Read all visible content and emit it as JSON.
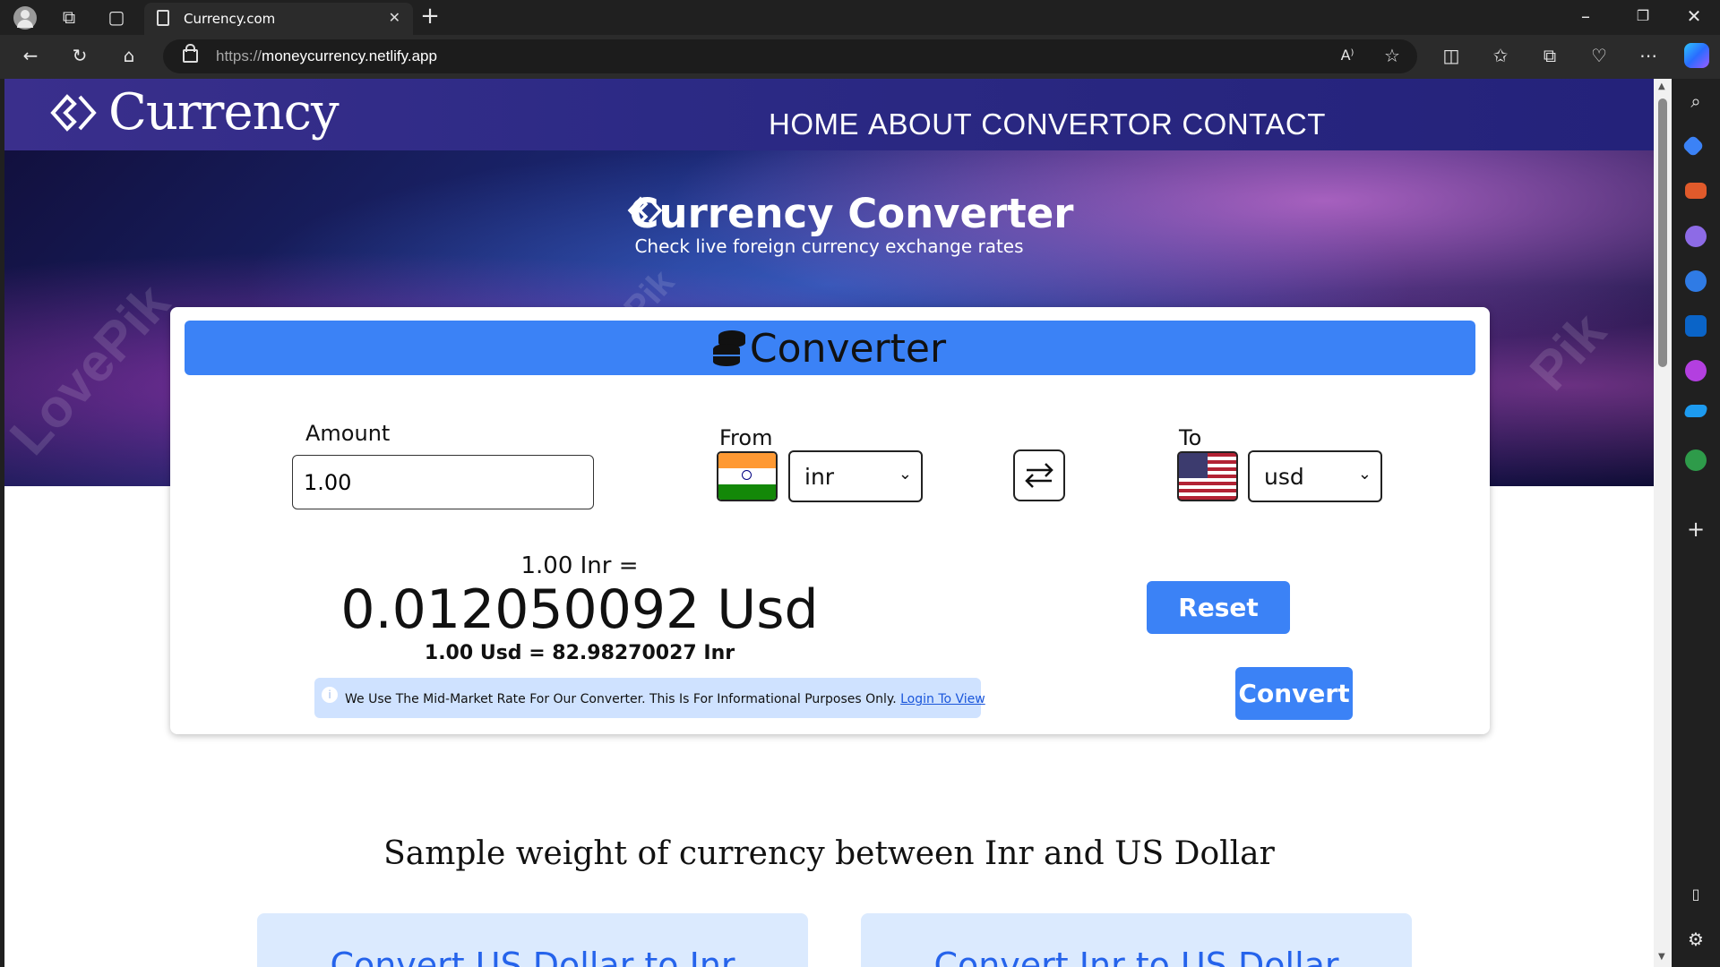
{
  "browser": {
    "tab_title": "Currency.com",
    "url_scheme": "https://",
    "url_host": "moneycurrency.netlify.app"
  },
  "nav": {
    "logo": "Currency",
    "links": [
      "HOME",
      "ABOUT",
      "CONVERTOR",
      "CONTACT"
    ]
  },
  "hero": {
    "title": "Currency Converter",
    "subtitle": "Check live foreign currency exchange rates"
  },
  "converter": {
    "header": "Converter",
    "amount_label": "Amount",
    "amount_value": "1.00",
    "from_label": "From",
    "from_value": "inr",
    "to_label": "To",
    "to_value": "usd",
    "result_from": "1.00 Inr =",
    "result_value": "0.012050092 Usd",
    "result_reverse": "1.00 Usd = 82.98270027 Inr",
    "note_text": "We Use The Mid-Market Rate For Our Converter. This Is For Informational Purposes Only.",
    "note_link": "Login To View",
    "reset_label": "Reset",
    "convert_label": "Convert"
  },
  "sample": {
    "title": "Sample weight of currency between Inr and US Dollar",
    "cards": [
      "Convert US Dollar to Inr",
      "Convert Inr to US Dollar"
    ]
  },
  "colors": {
    "accent": "#3b82f6",
    "nav_bg": "#2c2a85",
    "note_bg": "#cfe2ff"
  }
}
